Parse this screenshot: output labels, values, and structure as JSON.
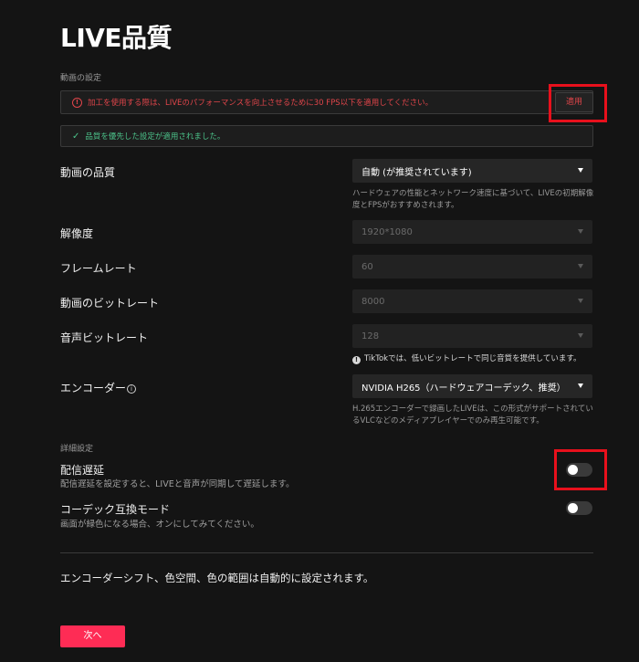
{
  "title": "LIVE品質",
  "video_settings_label": "動画の設定",
  "warning": {
    "icon": "!",
    "text": "加工を使用する際は、LIVEのパフォーマンスを向上させるために30 FPS以下を適用してください。",
    "apply_label": "適用"
  },
  "success": {
    "icon": "✓",
    "text": "品質を優先した設定が適用されました。"
  },
  "video_quality": {
    "label": "動画の品質",
    "value": "自動 (が推奨されています)",
    "hint": "ハードウェアの性能とネットワーク速度に基づいて、LIVEの初期解像度とFPSがおすすめされます。"
  },
  "resolution": {
    "label": "解像度",
    "value": "1920*1080"
  },
  "frame_rate": {
    "label": "フレームレート",
    "value": "60"
  },
  "video_bitrate": {
    "label": "動画のビットレート",
    "value": "8000"
  },
  "audio_bitrate": {
    "label": "音声ビットレート",
    "value": "128",
    "hint_icon": "!",
    "hint": "TikTokでは、低いビットレートで同じ音質を提供しています。"
  },
  "encoder": {
    "label": "エンコーダー",
    "info_icon": "i",
    "value": "NVIDIA H265（ハードウェアコーデック、推奨）",
    "hint": "H.265エンコーダーで録画したLIVEは、この形式がサポートされているVLCなどのメディアプレイヤーでのみ再生可能です。"
  },
  "advanced_label": "詳細設定",
  "stream_delay": {
    "label": "配信遅延",
    "description": "配信遅延を設定すると、LIVEと音声が同期して遅延します。",
    "enabled": false
  },
  "codec_compat": {
    "label": "コーデック互換モード",
    "description": "画面が緑色になる場合、オンにしてみてください。",
    "enabled": false
  },
  "footer_note": "エンコーダーシフト、色空間、色の範囲は自動的に設定されます。",
  "next_label": "次へ",
  "colors": {
    "accent": "#fe2c55",
    "warning": "#e0454a",
    "success": "#4cc38a",
    "highlight": "#e8101c"
  }
}
